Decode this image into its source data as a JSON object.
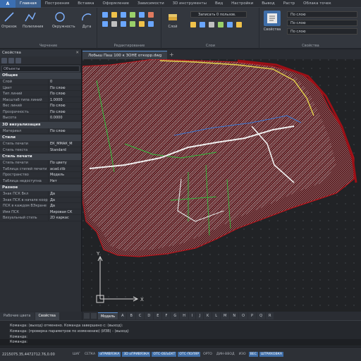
{
  "app": {
    "logo": "A"
  },
  "ribbon": {
    "tabs": [
      "Главная",
      "Построения",
      "Вставка",
      "Оформление",
      "Зависимости",
      "3D инструменты",
      "Вид",
      "Настройки",
      "Вывод",
      "Растр",
      "Облака точек"
    ],
    "active_tab": 0,
    "groups": {
      "draw": {
        "label": "Черчение",
        "tools": [
          "Отрезок",
          "Полилиния",
          "Окружность",
          "Дуга"
        ]
      },
      "edit": {
        "label": "Редактирование"
      },
      "layers": {
        "label": "Слои",
        "tool": "Слой",
        "layer_value": "Записать 0 пользов."
      },
      "props": {
        "label": "Свойства",
        "tool": "Свойства",
        "rows": [
          "По слою",
          "По слою",
          "По слою"
        ]
      }
    }
  },
  "document": {
    "tab": "Лобыш Паш 100 к ЗОНЕ откорр.dwg",
    "add": "+"
  },
  "properties": {
    "title": "Свойства",
    "select": "Объекты",
    "sections": [
      {
        "name": "Общие",
        "rows": [
          [
            "Слой",
            "0"
          ],
          [
            "Цвет",
            "По слою"
          ],
          [
            "Тип линий",
            "По слою"
          ],
          [
            "Масштаб типа линий",
            "1.0000"
          ],
          [
            "Вес линий",
            "По слою"
          ],
          [
            "Прозрачность",
            "По слою"
          ],
          [
            "Высота",
            "0.0000"
          ]
        ]
      },
      {
        "name": "3D визуализация",
        "rows": [
          [
            "Материал",
            "По слою"
          ]
        ]
      },
      {
        "name": "Стили",
        "rows": [
          [
            "Стиль печати",
            "ЕК_ММАК_М"
          ],
          [
            "Стиль текста",
            "Standard"
          ]
        ]
      },
      {
        "name": "Стиль печати",
        "rows": [
          [
            "Стиль печати",
            "По цвету"
          ],
          [
            "Таблица стилей печати",
            "acad.ctb"
          ],
          [
            "Пространство",
            "Модель"
          ],
          [
            "Таблица недоступна",
            "Нет"
          ]
        ]
      },
      {
        "name": "Разное",
        "rows": [
          [
            "Знак ПСК Вкл",
            "Да"
          ],
          [
            "Знак ПСК в начале коорд.",
            "Да"
          ],
          [
            "ПСК в каждом ВЭкране",
            "Да"
          ],
          [
            "Имя ПСК",
            "Мировая СК"
          ],
          [
            "Визуальный стиль",
            "2D каркас"
          ]
        ]
      }
    ]
  },
  "panel_tabs": [
    "Рабочие цвета",
    "Свойства"
  ],
  "model_tabs": [
    "Модель",
    "A",
    "B",
    "C",
    "D",
    "E",
    "F",
    "G",
    "H",
    "I",
    "J",
    "K",
    "L",
    "M",
    "N",
    "O",
    "P",
    "Q",
    "R"
  ],
  "command": {
    "lines": [
      "Команда: (выход) отменено. Команда завершено с: (выход): ",
      "Команда: (проверка параметров по изменению) (ИЗВ) - (выход) ",
      "Команда: "
    ],
    "prompt": "Команда:"
  },
  "statusbar": {
    "coords": "2215075.35,4472712.76,0.00",
    "toggles": [
      {
        "label": "ШАГ",
        "on": false
      },
      {
        "label": "СЕТКА",
        "on": false
      },
      {
        "label": "оПРИВЯЗКА",
        "on": true
      },
      {
        "label": "3D оПРИВЯЗКА",
        "on": true
      },
      {
        "label": "ОТС-ОБЪЕКТ",
        "on": true
      },
      {
        "label": "ОТС-ПОЛЯР",
        "on": true
      },
      {
        "label": "ОРТО",
        "on": false
      },
      {
        "label": "ДИН-ВВОД",
        "on": false
      },
      {
        "label": "ИЗО",
        "on": false
      },
      {
        "label": "ВЕС",
        "on": true
      },
      {
        "label": "ШТРИХОВКА",
        "on": true
      }
    ]
  },
  "ucs": {
    "x": "X",
    "y": "Y"
  },
  "colors": {
    "accent": "#3c5f8c",
    "drawing_red": "#b8151c",
    "drawing_white": "#e6e6e6",
    "drawing_green": "#2fbf3a",
    "drawing_yellow": "#e3d24a"
  }
}
